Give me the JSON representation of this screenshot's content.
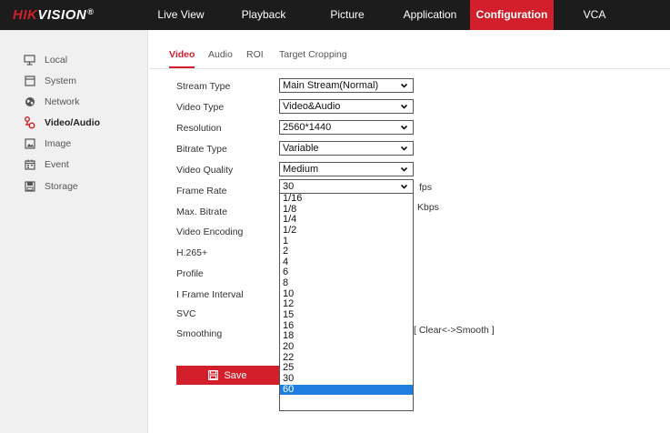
{
  "brand": {
    "logo_red": "HIK",
    "logo_white": "VISION",
    "logo_mark": "®"
  },
  "topnav": {
    "items": [
      {
        "label": "Live View",
        "active": false
      },
      {
        "label": "Playback",
        "active": false
      },
      {
        "label": "Picture",
        "active": false
      },
      {
        "label": "Application",
        "active": false
      },
      {
        "label": "Configuration",
        "active": true
      },
      {
        "label": "VCA",
        "active": false
      }
    ]
  },
  "sidebar": {
    "items": [
      {
        "label": "Local",
        "icon": "monitor-icon",
        "active": false
      },
      {
        "label": "System",
        "icon": "system-window-icon",
        "active": false
      },
      {
        "label": "Network",
        "icon": "globe-icon",
        "active": false
      },
      {
        "label": "Video/Audio",
        "icon": "video-audio-icon",
        "active": true
      },
      {
        "label": "Image",
        "icon": "image-icon",
        "active": false
      },
      {
        "label": "Event",
        "icon": "calendar-icon",
        "active": false
      },
      {
        "label": "Storage",
        "icon": "storage-disk-icon",
        "active": false
      }
    ]
  },
  "tabs": [
    {
      "label": "Video",
      "active": true
    },
    {
      "label": "Audio",
      "active": false
    },
    {
      "label": "ROI",
      "active": false
    },
    {
      "label": "Target Cropping",
      "active": false
    }
  ],
  "form": {
    "stream_type": {
      "label": "Stream Type",
      "value": "Main Stream(Normal)"
    },
    "video_type": {
      "label": "Video Type",
      "value": "Video&Audio"
    },
    "resolution": {
      "label": "Resolution",
      "value": "2560*1440"
    },
    "bitrate_type": {
      "label": "Bitrate Type",
      "value": "Variable"
    },
    "video_quality": {
      "label": "Video Quality",
      "value": "Medium"
    },
    "frame_rate": {
      "label": "Frame Rate",
      "value": "30",
      "unit": "fps"
    },
    "max_bitrate": {
      "label": "Max. Bitrate",
      "unit": "Kbps"
    },
    "video_encoding": {
      "label": "Video Encoding"
    },
    "h265plus": {
      "label": "H.265+"
    },
    "profile": {
      "label": "Profile"
    },
    "i_frame_interval": {
      "label": "I Frame Interval"
    },
    "svc": {
      "label": "SVC"
    },
    "smoothing": {
      "label": "Smoothing",
      "hint": "[ Clear<->Smooth ]"
    }
  },
  "frame_rate_options": [
    "1/16",
    "1/8",
    "1/4",
    "1/2",
    "1",
    "2",
    "4",
    "6",
    "8",
    "10",
    "12",
    "15",
    "16",
    "18",
    "20",
    "22",
    "25",
    "30",
    "60"
  ],
  "frame_rate_highlighted": "60",
  "save_label": "Save",
  "colors": {
    "accent": "#d21f2b",
    "topbar": "#1c1c1c",
    "highlight": "#1e7fe0",
    "sidebar_bg": "#f0f0f0"
  }
}
